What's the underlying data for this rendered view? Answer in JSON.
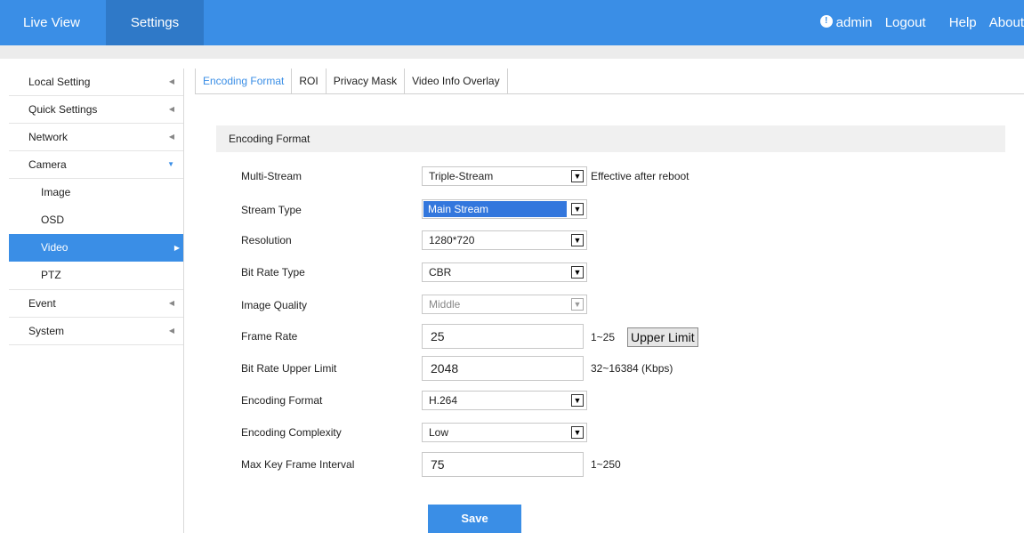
{
  "topbar": {
    "tabs": [
      "Live View",
      "Settings"
    ],
    "user": "admin",
    "logout": "Logout",
    "help": "Help",
    "about": "About"
  },
  "sidebar": {
    "local_setting": "Local Setting",
    "quick_settings": "Quick Settings",
    "network": "Network",
    "camera": "Camera",
    "camera_sub": [
      "Image",
      "OSD",
      "Video",
      "PTZ"
    ],
    "event": "Event",
    "system": "System",
    "active_item": "Video"
  },
  "tabs": [
    "Encoding Format",
    "ROI",
    "Privacy Mask",
    "Video Info Overlay"
  ],
  "section_title": "Encoding Format",
  "form": {
    "multi_stream": {
      "label": "Multi-Stream",
      "value": "Triple-Stream",
      "hint": "Effective after reboot"
    },
    "stream_type": {
      "label": "Stream Type",
      "value": "Main Stream"
    },
    "resolution": {
      "label": "Resolution",
      "value": "1280*720"
    },
    "bit_rate_type": {
      "label": "Bit Rate Type",
      "value": "CBR"
    },
    "image_quality": {
      "label": "Image Quality",
      "value": "Middle"
    },
    "frame_rate": {
      "label": "Frame Rate",
      "value": "25",
      "hint": "1~25",
      "button": "Upper Limit"
    },
    "bit_rate_upper": {
      "label": "Bit Rate Upper Limit",
      "value": "2048",
      "hint": "32~16384 (Kbps)"
    },
    "encoding_format": {
      "label": "Encoding Format",
      "value": "H.264"
    },
    "encoding_complexity": {
      "label": "Encoding Complexity",
      "value": "Low"
    },
    "max_key_frame": {
      "label": "Max Key Frame Interval",
      "value": "75",
      "hint": "1~250"
    }
  },
  "save_label": "Save",
  "colors": {
    "accent": "#3a8ee6",
    "selected_bg": "#3377dd"
  }
}
